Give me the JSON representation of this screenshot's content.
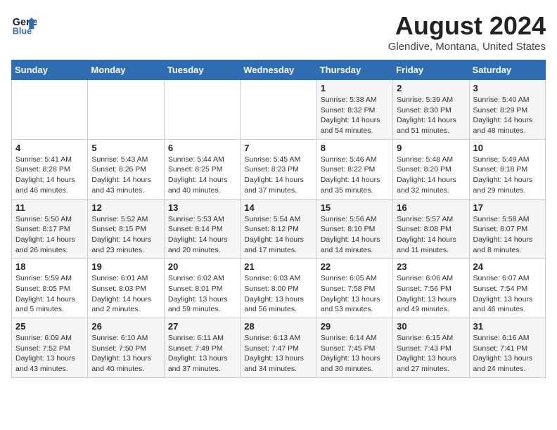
{
  "header": {
    "logo_line1": "General",
    "logo_line2": "Blue",
    "title": "August 2024",
    "subtitle": "Glendive, Montana, United States"
  },
  "days_of_week": [
    "Sunday",
    "Monday",
    "Tuesday",
    "Wednesday",
    "Thursday",
    "Friday",
    "Saturday"
  ],
  "weeks": [
    [
      {
        "num": "",
        "info": ""
      },
      {
        "num": "",
        "info": ""
      },
      {
        "num": "",
        "info": ""
      },
      {
        "num": "",
        "info": ""
      },
      {
        "num": "1",
        "info": "Sunrise: 5:38 AM\nSunset: 8:32 PM\nDaylight: 14 hours\nand 54 minutes."
      },
      {
        "num": "2",
        "info": "Sunrise: 5:39 AM\nSunset: 8:30 PM\nDaylight: 14 hours\nand 51 minutes."
      },
      {
        "num": "3",
        "info": "Sunrise: 5:40 AM\nSunset: 8:29 PM\nDaylight: 14 hours\nand 48 minutes."
      }
    ],
    [
      {
        "num": "4",
        "info": "Sunrise: 5:41 AM\nSunset: 8:28 PM\nDaylight: 14 hours\nand 46 minutes."
      },
      {
        "num": "5",
        "info": "Sunrise: 5:43 AM\nSunset: 8:26 PM\nDaylight: 14 hours\nand 43 minutes."
      },
      {
        "num": "6",
        "info": "Sunrise: 5:44 AM\nSunset: 8:25 PM\nDaylight: 14 hours\nand 40 minutes."
      },
      {
        "num": "7",
        "info": "Sunrise: 5:45 AM\nSunset: 8:23 PM\nDaylight: 14 hours\nand 37 minutes."
      },
      {
        "num": "8",
        "info": "Sunrise: 5:46 AM\nSunset: 8:22 PM\nDaylight: 14 hours\nand 35 minutes."
      },
      {
        "num": "9",
        "info": "Sunrise: 5:48 AM\nSunset: 8:20 PM\nDaylight: 14 hours\nand 32 minutes."
      },
      {
        "num": "10",
        "info": "Sunrise: 5:49 AM\nSunset: 8:18 PM\nDaylight: 14 hours\nand 29 minutes."
      }
    ],
    [
      {
        "num": "11",
        "info": "Sunrise: 5:50 AM\nSunset: 8:17 PM\nDaylight: 14 hours\nand 26 minutes."
      },
      {
        "num": "12",
        "info": "Sunrise: 5:52 AM\nSunset: 8:15 PM\nDaylight: 14 hours\nand 23 minutes."
      },
      {
        "num": "13",
        "info": "Sunrise: 5:53 AM\nSunset: 8:14 PM\nDaylight: 14 hours\nand 20 minutes."
      },
      {
        "num": "14",
        "info": "Sunrise: 5:54 AM\nSunset: 8:12 PM\nDaylight: 14 hours\nand 17 minutes."
      },
      {
        "num": "15",
        "info": "Sunrise: 5:56 AM\nSunset: 8:10 PM\nDaylight: 14 hours\nand 14 minutes."
      },
      {
        "num": "16",
        "info": "Sunrise: 5:57 AM\nSunset: 8:08 PM\nDaylight: 14 hours\nand 11 minutes."
      },
      {
        "num": "17",
        "info": "Sunrise: 5:58 AM\nSunset: 8:07 PM\nDaylight: 14 hours\nand 8 minutes."
      }
    ],
    [
      {
        "num": "18",
        "info": "Sunrise: 5:59 AM\nSunset: 8:05 PM\nDaylight: 14 hours\nand 5 minutes."
      },
      {
        "num": "19",
        "info": "Sunrise: 6:01 AM\nSunset: 8:03 PM\nDaylight: 14 hours\nand 2 minutes."
      },
      {
        "num": "20",
        "info": "Sunrise: 6:02 AM\nSunset: 8:01 PM\nDaylight: 13 hours\nand 59 minutes."
      },
      {
        "num": "21",
        "info": "Sunrise: 6:03 AM\nSunset: 8:00 PM\nDaylight: 13 hours\nand 56 minutes."
      },
      {
        "num": "22",
        "info": "Sunrise: 6:05 AM\nSunset: 7:58 PM\nDaylight: 13 hours\nand 53 minutes."
      },
      {
        "num": "23",
        "info": "Sunrise: 6:06 AM\nSunset: 7:56 PM\nDaylight: 13 hours\nand 49 minutes."
      },
      {
        "num": "24",
        "info": "Sunrise: 6:07 AM\nSunset: 7:54 PM\nDaylight: 13 hours\nand 46 minutes."
      }
    ],
    [
      {
        "num": "25",
        "info": "Sunrise: 6:09 AM\nSunset: 7:52 PM\nDaylight: 13 hours\nand 43 minutes."
      },
      {
        "num": "26",
        "info": "Sunrise: 6:10 AM\nSunset: 7:50 PM\nDaylight: 13 hours\nand 40 minutes."
      },
      {
        "num": "27",
        "info": "Sunrise: 6:11 AM\nSunset: 7:49 PM\nDaylight: 13 hours\nand 37 minutes."
      },
      {
        "num": "28",
        "info": "Sunrise: 6:13 AM\nSunset: 7:47 PM\nDaylight: 13 hours\nand 34 minutes."
      },
      {
        "num": "29",
        "info": "Sunrise: 6:14 AM\nSunset: 7:45 PM\nDaylight: 13 hours\nand 30 minutes."
      },
      {
        "num": "30",
        "info": "Sunrise: 6:15 AM\nSunset: 7:43 PM\nDaylight: 13 hours\nand 27 minutes."
      },
      {
        "num": "31",
        "info": "Sunrise: 6:16 AM\nSunset: 7:41 PM\nDaylight: 13 hours\nand 24 minutes."
      }
    ]
  ]
}
